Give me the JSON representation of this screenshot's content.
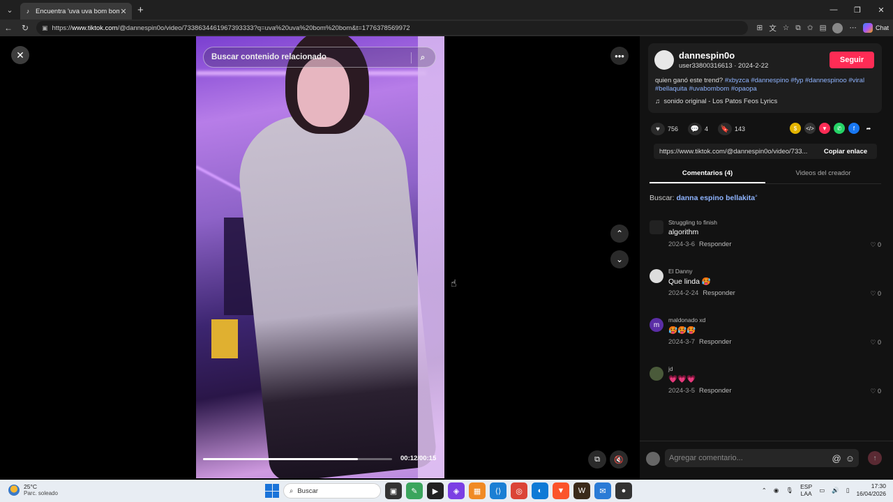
{
  "browser": {
    "tab_title": "Encuentra 'uva uva bom bom' en",
    "url_prefix": "https://",
    "url_host": "www.tiktok.com",
    "url_rest": "/@dannespin0o/video/7338634461967393333?q=uva%20uva%20bom%20bom&t=1776378569972",
    "chat_label": "Chat"
  },
  "video": {
    "search_placeholder": "Buscar contenido relacionado",
    "time": "00:12/00:15",
    "progress": 0.82
  },
  "author": {
    "name": "dannespin0o",
    "sub": "user33800316613 · 2024-2-22",
    "follow_label": "Seguir",
    "desc_text": "quien ganó este trend? ",
    "tags": [
      "#xbyzca",
      "#dannespino",
      "#fyp",
      "#dannespinoo",
      "#viral",
      "#bellaquita",
      "#uvabombom",
      "#opaopa"
    ],
    "music": "sonido original - Los Patos Feos Lyrics"
  },
  "stats": {
    "likes": "756",
    "comments": "4",
    "saves": "143"
  },
  "link": {
    "url": "https://www.tiktok.com/@dannespin0o/video/733...",
    "copy_label": "Copiar enlace"
  },
  "tabs": {
    "comments": "Comentarios (4)",
    "creator": "Videos del creador"
  },
  "search_suggest": {
    "label": "Buscar: ",
    "query": "danna espino bellakita"
  },
  "comments": [
    {
      "user": "Struggling to finish",
      "text": "algorithm",
      "date": "2024-3-6",
      "reply": "Responder",
      "likes": "0",
      "avatar": ""
    },
    {
      "user": "El Danny",
      "text": "Que linda 🥵",
      "date": "2024-2-24",
      "reply": "Responder",
      "likes": "0",
      "avatar": ""
    },
    {
      "user": "maldonado xd",
      "text": "🥵🥵🥵",
      "date": "2024-3-7",
      "reply": "Responder",
      "likes": "0",
      "avatar": "m"
    },
    {
      "user": "jd",
      "text": "💗💗💗",
      "date": "2024-3-5",
      "reply": "Responder",
      "likes": "0",
      "avatar": ""
    }
  ],
  "comment_box": {
    "placeholder": "Agregar comentario..."
  },
  "taskbar": {
    "temp": "25°C",
    "weather": "Parc. soleado",
    "search": "Buscar",
    "lang1": "ESP",
    "lang2": "LAA",
    "time": "17:30",
    "date": "16/04/2026"
  }
}
